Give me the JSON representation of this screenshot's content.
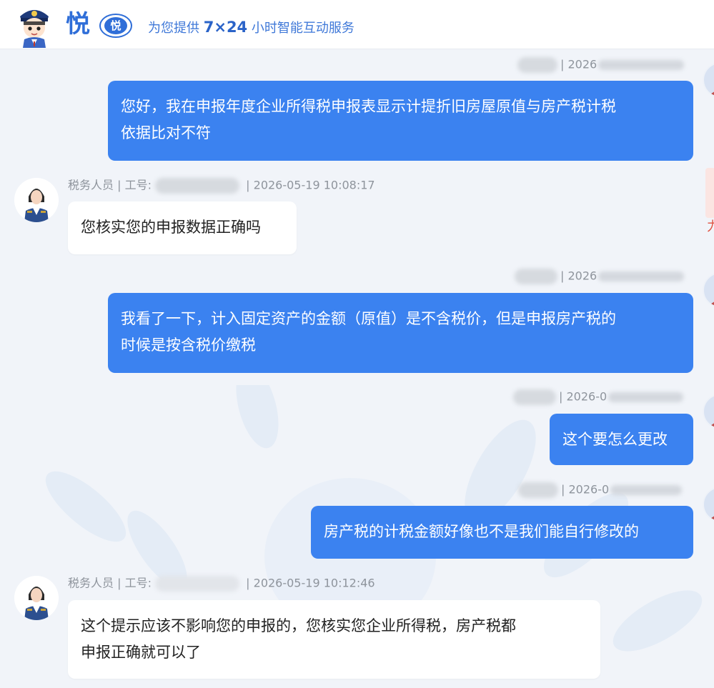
{
  "header": {
    "brand_char": "悦",
    "badge_char": "悦",
    "tagline_prefix": "为您提供",
    "tagline_strong": "7×24",
    "tagline_suffix": "小时智能互动服务"
  },
  "messages": [
    {
      "role": "user",
      "meta_text": "| 2026",
      "text_lines": [
        "您好，我在申报年度企业所得税申报表显示计提折旧房屋原值与房产税计税",
        "依据比对不符"
      ]
    },
    {
      "role": "agent",
      "sender": "税务人员 | 工号:",
      "time": "| 2026-05-19 10:08:17",
      "text_lines": [
        "您核实您的申报数据正确吗"
      ]
    },
    {
      "role": "user",
      "meta_text": "| 2026",
      "text_lines": [
        "我看了一下，计入固定资产的金额（原值）是不含税价，但是申报房产税的",
        "时候是按含税价缴税"
      ]
    },
    {
      "role": "user",
      "meta_text": "| 2026-0",
      "text_lines": [
        "这个要怎么更改"
      ]
    },
    {
      "role": "user",
      "meta_text": "| 2026-0",
      "text_lines": [
        "房产税的计税金额好像也不是我们能自行修改的"
      ]
    },
    {
      "role": "agent",
      "sender": "税务人员 | 工号:",
      "time": "| 2026-05-19 10:12:46",
      "text_lines": [
        "这个提示应该不影响您的申报的，您核实您企业所得税，房产税都",
        "申报正确就可以了"
      ]
    }
  ],
  "edge_char": "力",
  "colors": {
    "brand_blue": "#2f6ed8",
    "user_bubble": "#3b82f0",
    "agent_bubble": "#ffffff",
    "background": "#f1f4f9",
    "meta_text": "#8e949c"
  },
  "icons": {
    "robot_avatar": "police-robot-avatar-icon",
    "brand_badge": "yue-badge-icon",
    "agent_avatar": "tax-officer-avatar-icon",
    "user_avatar": "user-avatar-icon"
  }
}
